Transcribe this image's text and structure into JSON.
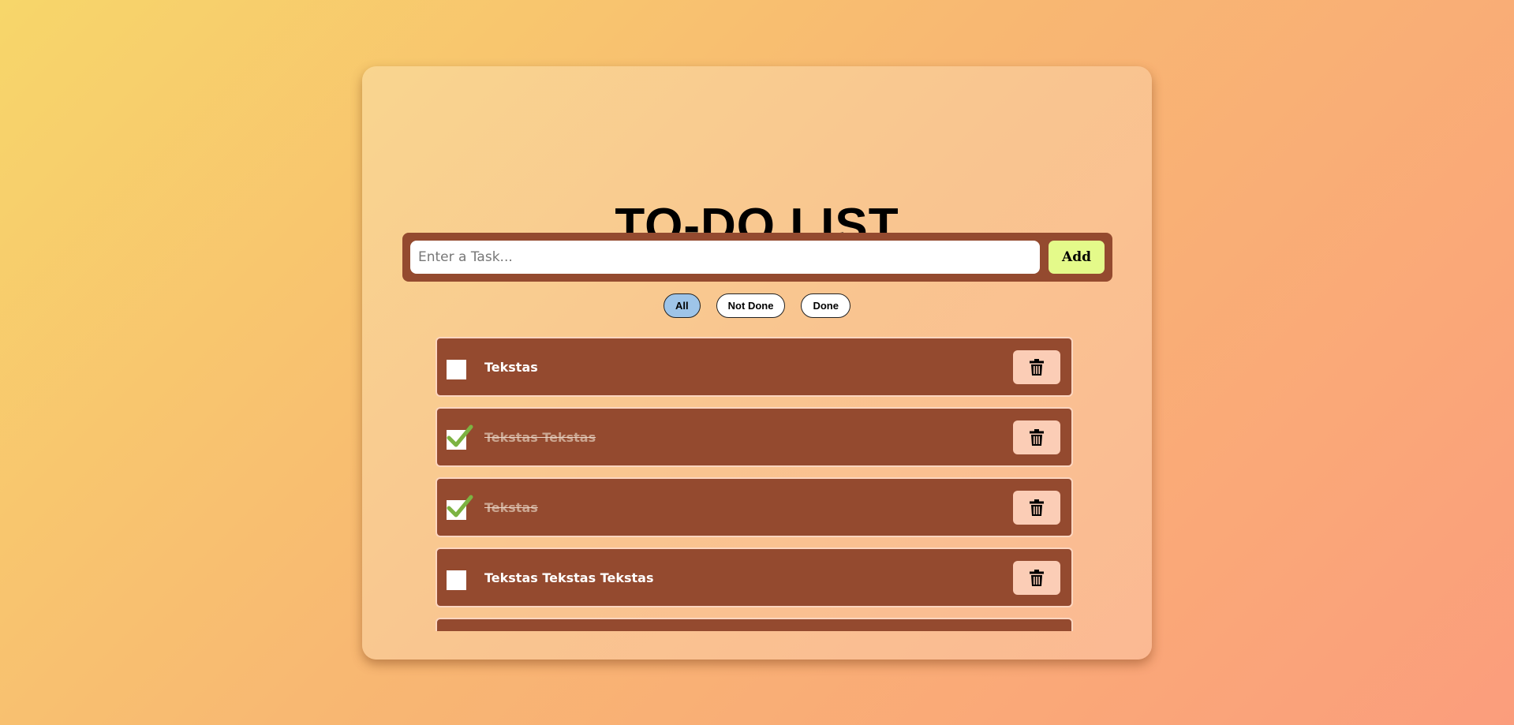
{
  "app": {
    "title": "TO-DO LIST"
  },
  "input": {
    "placeholder": "Enter a Task...",
    "value": ""
  },
  "add_button": {
    "label": "Add"
  },
  "filters": [
    {
      "label": "All",
      "active": true
    },
    {
      "label": "Not Done",
      "active": false
    },
    {
      "label": "Done",
      "active": false
    }
  ],
  "tasks": [
    {
      "text": "Tekstas",
      "done": false
    },
    {
      "text": "Tekstas Tekstas",
      "done": true
    },
    {
      "text": "Tekstas",
      "done": true
    },
    {
      "text": "Tekstas Tekstas Tekstas",
      "done": false
    },
    {
      "text": "",
      "done": false
    }
  ],
  "icons": {
    "check": "checkmark-icon",
    "delete": "trash-icon"
  },
  "colors": {
    "task_background": "#944a2f",
    "add_button": "#e4fa8a",
    "active_filter": "#9ec4e8",
    "delete_button": "#fbcdb6",
    "checkmark": "#7cb342"
  }
}
